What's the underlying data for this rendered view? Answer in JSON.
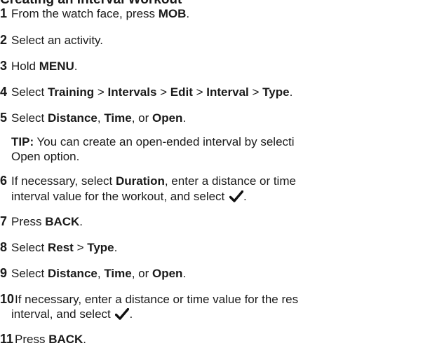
{
  "heading": "Creating an Interval Workout",
  "steps": [
    {
      "num": "1",
      "parts": [
        "From the watch face, press ",
        "MOB",
        "."
      ]
    },
    {
      "num": "2",
      "text": "Select an activity."
    },
    {
      "num": "3",
      "parts": [
        "Hold ",
        "MENU",
        "."
      ]
    },
    {
      "num": "4",
      "parts": [
        "Select ",
        "Training",
        " > ",
        "Intervals",
        " > ",
        "Edit",
        " > ",
        "Interval",
        " > ",
        "Type",
        "."
      ]
    },
    {
      "num": "5",
      "parts": [
        "Select ",
        "Distance",
        ", ",
        "Time",
        ", or ",
        "Open",
        "."
      ]
    },
    {
      "num": "6",
      "parts": [
        "If necessary, select ",
        "Duration",
        ", enter a distance or time"
      ],
      "line2": "interval value for the workout, and select "
    },
    {
      "num": "7",
      "parts": [
        "Press ",
        "BACK",
        "."
      ]
    },
    {
      "num": "8",
      "parts": [
        "Select ",
        "Rest",
        " > ",
        "Type",
        "."
      ]
    },
    {
      "num": "9",
      "parts": [
        "Select ",
        "Distance",
        ", ",
        "Time",
        ", or ",
        "Open",
        "."
      ]
    },
    {
      "num": "10",
      "line1": "If necessary, enter a distance or time value for the res",
      "line2": "interval, and select "
    },
    {
      "num": "11",
      "parts": [
        "Press ",
        "BACK",
        "."
      ]
    }
  ],
  "tip": {
    "label": "TIP:",
    "line1": " You can create an open-ended interval by selecti",
    "line2": "Open option."
  },
  "icons": {
    "confirm": "checkmark-icon"
  }
}
